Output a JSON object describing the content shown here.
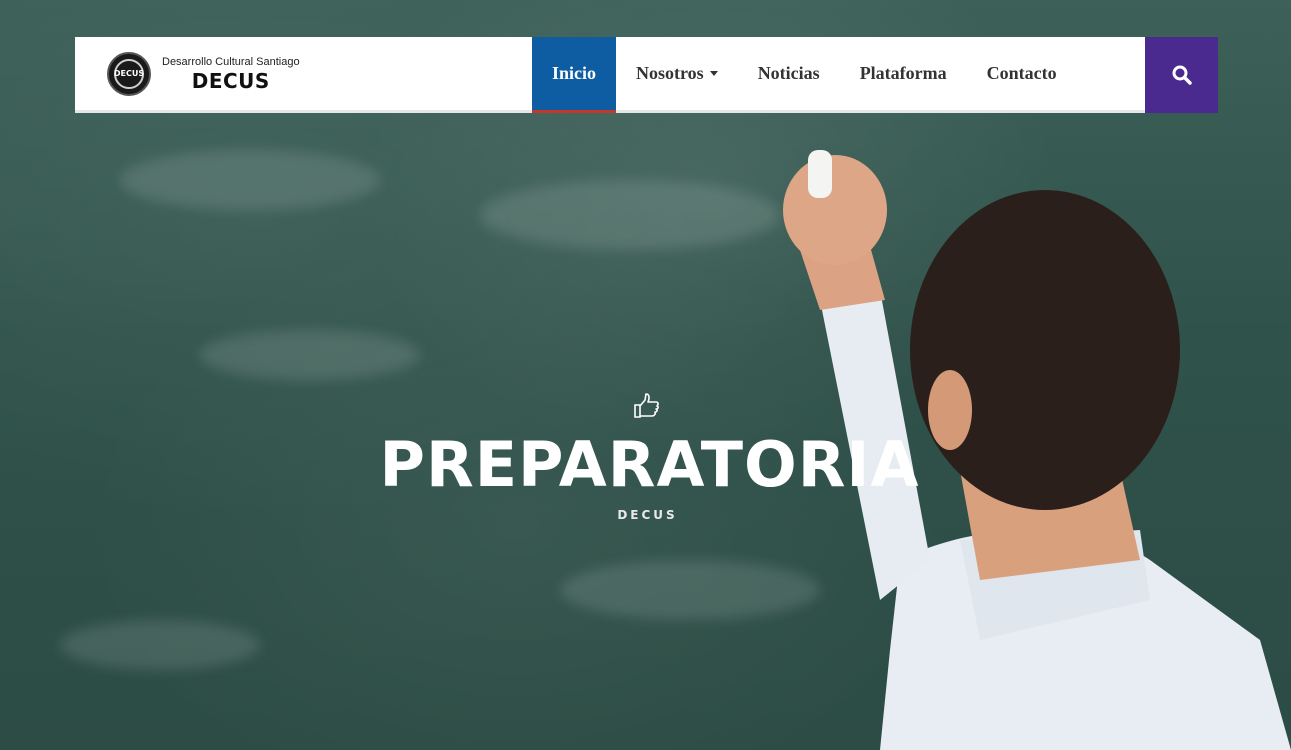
{
  "brand": {
    "logo_text": "DECUS",
    "subtitle": "Desarrollo Cultural Santiago",
    "name": "DECUS"
  },
  "nav": {
    "items": [
      {
        "label": "Inicio",
        "active": true
      },
      {
        "label": "Nosotros",
        "dropdown": true
      },
      {
        "label": "Noticias"
      },
      {
        "label": "Plataforma"
      },
      {
        "label": "Contacto"
      }
    ],
    "search_icon": "search-icon"
  },
  "hero": {
    "icon": "thumbs-up-icon",
    "title": "PREPARATORIA",
    "subtitle": "DECUS"
  },
  "colors": {
    "active_nav": "#0e5da3",
    "search_bg": "#4a2a8f",
    "chalkboard": "#2f524a"
  }
}
